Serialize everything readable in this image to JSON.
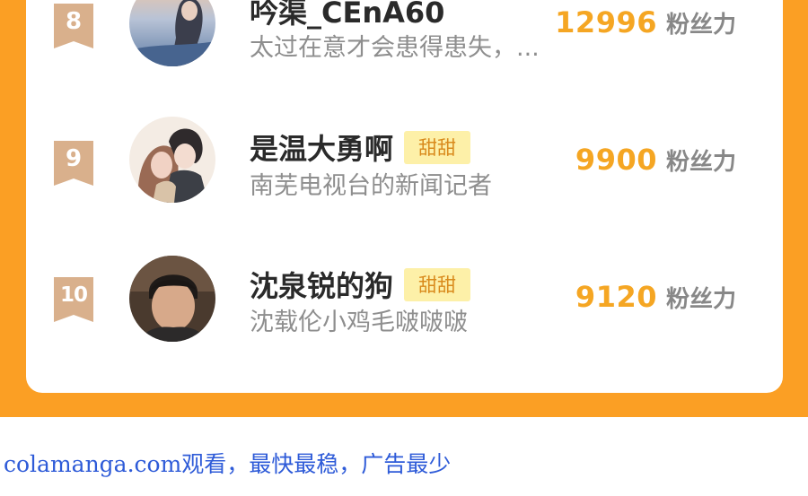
{
  "leaderboard": {
    "unit_label": "粉丝力",
    "rows": [
      {
        "rank": "8",
        "name": "吟渠_CEnA60",
        "badge": "",
        "desc": "太过在意才会患得患失，...",
        "score": "12996"
      },
      {
        "rank": "9",
        "name": "是温大勇啊",
        "badge": "甜甜",
        "desc": "南芜电视台的新闻记者",
        "score": "9900"
      },
      {
        "rank": "10",
        "name": "沈泉锐的狗",
        "badge": "甜甜",
        "desc": "沈载伦小鸡毛啵啵啵",
        "score": "9120"
      }
    ]
  },
  "colors": {
    "background_accent": "#fb9f24",
    "rank_badge": "#d9b08c",
    "score": "#f5a623",
    "badge_bg": "#fdf0a8",
    "footer_text": "#2e5bd8"
  },
  "footer": {
    "text": "colamanga.com观看，最快最稳，广告最少"
  }
}
